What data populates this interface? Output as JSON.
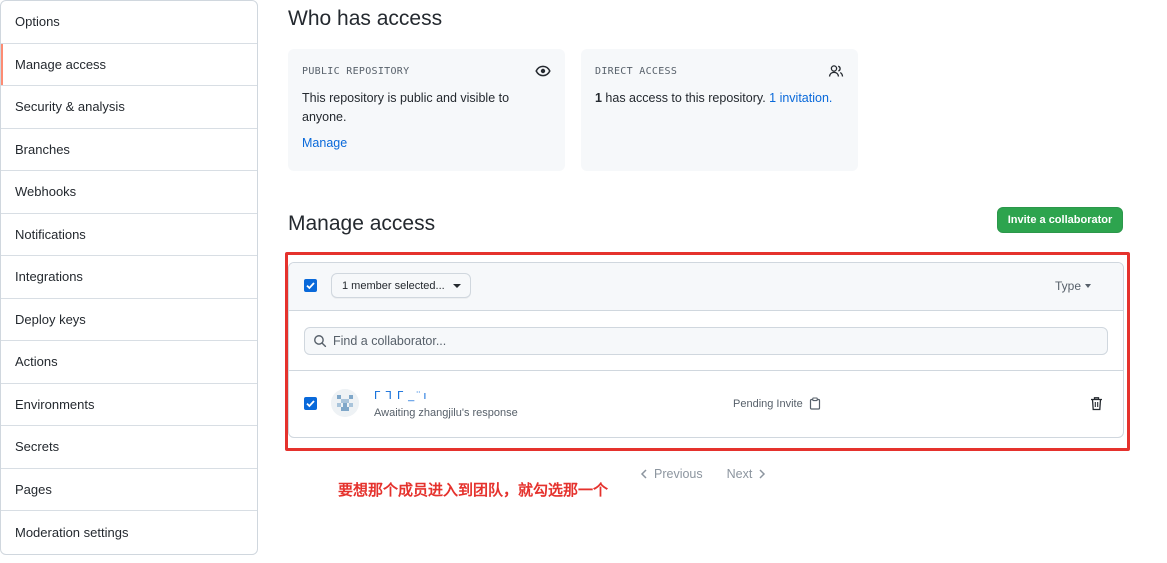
{
  "sidebar": {
    "items": [
      {
        "label": "Options"
      },
      {
        "label": "Manage access"
      },
      {
        "label": "Security & analysis"
      },
      {
        "label": "Branches"
      },
      {
        "label": "Webhooks"
      },
      {
        "label": "Notifications"
      },
      {
        "label": "Integrations"
      },
      {
        "label": "Deploy keys"
      },
      {
        "label": "Actions"
      },
      {
        "label": "Environments"
      },
      {
        "label": "Secrets"
      },
      {
        "label": "Pages"
      },
      {
        "label": "Moderation settings"
      }
    ],
    "active": "Manage access"
  },
  "who_has_access": {
    "title": "Who has access",
    "public_card": {
      "title": "PUBLIC REPOSITORY",
      "icon": "eye-icon",
      "text": "This repository is public and visible to anyone.",
      "link": "Manage"
    },
    "direct_card": {
      "title": "DIRECT ACCESS",
      "icon": "people-icon",
      "count": "1",
      "text": " has access to this repository. ",
      "link": "1 invitation."
    }
  },
  "manage_access": {
    "title": "Manage access",
    "invite_button": "Invite a collaborator",
    "header": {
      "select_label": "1 member selected...",
      "type_filter": "Type"
    },
    "search": {
      "placeholder": "Find a collaborator..."
    },
    "members": [
      {
        "name": "ᒥ ᒣ ᒥ _ ̈ ı",
        "subtitle": "Awaiting zhangjilu's response",
        "status": "Pending Invite",
        "checked": true
      }
    ]
  },
  "annotation": "要想那个成员进入到团队，就勾选那一个",
  "pagination": {
    "previous": "Previous",
    "next": "Next"
  },
  "colors": {
    "accent_blue": "#0969da",
    "invite_green": "#2da44e",
    "highlight_red": "#e5322d",
    "active_marker": "#fd8c73"
  }
}
